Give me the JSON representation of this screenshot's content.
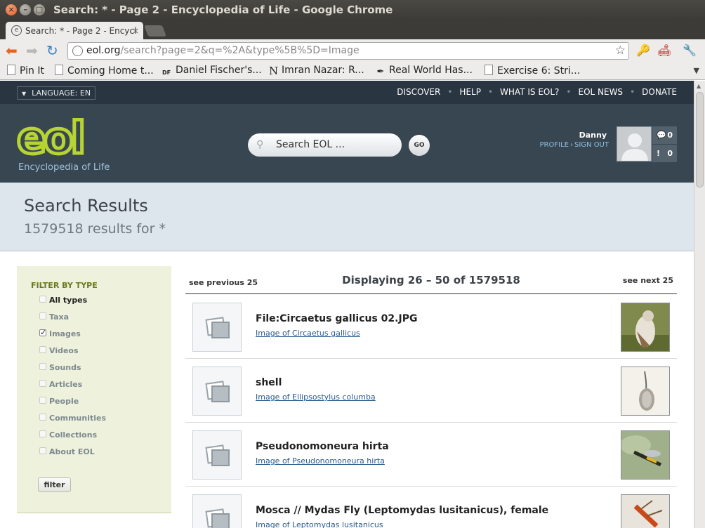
{
  "window": {
    "title": "Search: * - Page 2 - Encyclopedia of Life - Google Chrome"
  },
  "tab": {
    "label": "Search: * - Page 2 - Encycl"
  },
  "omnibox": {
    "host": "eol.org",
    "path": "/search?page=2&q=%2A&type%5B%5D=Image"
  },
  "bookmarks": [
    {
      "label": "Pin It"
    },
    {
      "label": "Coming Home t..."
    },
    {
      "label": "Daniel Fischer's..."
    },
    {
      "label": "Imran Nazar: R..."
    },
    {
      "label": "Real World Has..."
    },
    {
      "label": "Exercise 6: Stri..."
    }
  ],
  "topbar": {
    "language": "LANGUAGE: EN",
    "nav": [
      "DISCOVER",
      "HELP",
      "WHAT IS EOL?",
      "EOL NEWS",
      "DONATE"
    ]
  },
  "header": {
    "logo_text": "eol",
    "tagline": "Encyclopedia of Life",
    "search_placeholder": "Search EOL ...",
    "go_label": "GO",
    "user_name": "Danny",
    "profile_link": "PROFILE",
    "signout_link": "SIGN OUT",
    "comments_count": "0",
    "alerts_count": "0"
  },
  "results_header": {
    "title": "Search Results",
    "subtitle": "1579518 results for  *"
  },
  "filter": {
    "heading": "FILTER BY TYPE",
    "items": [
      {
        "label": "All types",
        "checked": false
      },
      {
        "label": "Taxa",
        "checked": false
      },
      {
        "label": "Images",
        "checked": true
      },
      {
        "label": "Videos",
        "checked": false
      },
      {
        "label": "Sounds",
        "checked": false
      },
      {
        "label": "Articles",
        "checked": false
      },
      {
        "label": "People",
        "checked": false
      },
      {
        "label": "Communities",
        "checked": false
      },
      {
        "label": "Collections",
        "checked": false
      },
      {
        "label": "About EOL",
        "checked": false
      }
    ],
    "button_label": "filter"
  },
  "pager": {
    "prev": "see previous 25",
    "display": "Displaying 26 – 50 of 1579518",
    "next": "see next 25"
  },
  "results": [
    {
      "title": "File:Circaetus gallicus 02.JPG",
      "subtitle": "Image of Circaetus gallicus"
    },
    {
      "title": "shell",
      "subtitle": "Image of Ellipsostylus columba"
    },
    {
      "title": "Pseudonomoneura hirta",
      "subtitle": "Image of Pseudonomoneura hirta"
    },
    {
      "title": "Mosca // Mydas Fly (Leptomydas lusitanicus), female",
      "subtitle": "Image of Leptomydas lusitanicus"
    }
  ]
}
